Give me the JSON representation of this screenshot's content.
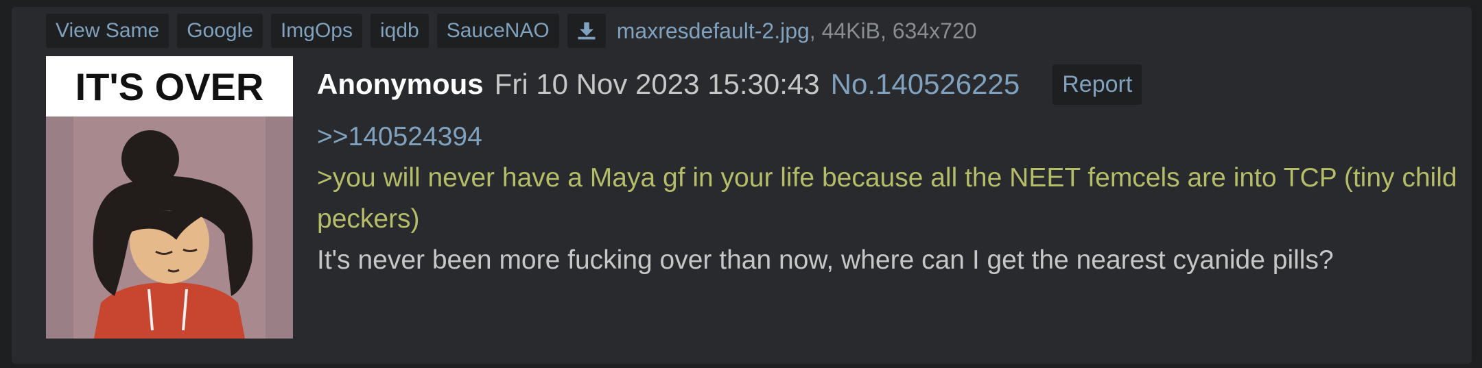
{
  "file_bar": {
    "buttons": [
      {
        "label": "View Same"
      },
      {
        "label": "Google"
      },
      {
        "label": "ImgOps"
      },
      {
        "label": "iqdb"
      },
      {
        "label": "SauceNAO"
      }
    ],
    "download_icon": "download-icon",
    "filename": "maxresdefault-2.jpg",
    "size": "44KiB",
    "dimensions": "634x720"
  },
  "thumbnail": {
    "caption": "IT'S OVER"
  },
  "post": {
    "name": "Anonymous",
    "datetime": "Fri 10 Nov 2023 15:30:43",
    "number": "No.140526225",
    "report_label": "Report",
    "quote_link": ">>140524394",
    "greentext": ">you will never have a Maya gf in your life because all the NEET femcels are into TCP (tiny child peckers)",
    "message": "It's never been more fucking over than now, where can I get the nearest cyanide pills?"
  },
  "colors": {
    "page_bg": "#1d1f21",
    "post_bg": "#282a2e",
    "link": "#81a2be",
    "greentext": "#b5bd68",
    "text": "#c5c8c6"
  }
}
